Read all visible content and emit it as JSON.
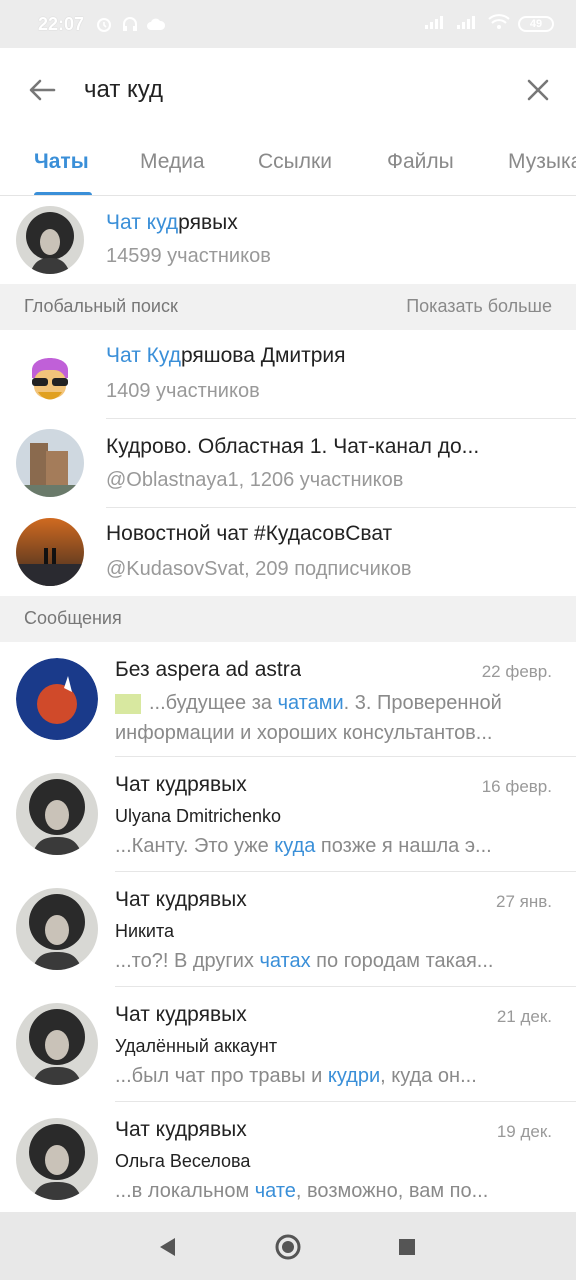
{
  "status_bar": {
    "time": "22:07",
    "battery": "49",
    "icons": [
      "alarm-icon",
      "headset-icon",
      "cloud-icon",
      "signal-icon",
      "signal-icon",
      "wifi-icon",
      "battery-icon"
    ]
  },
  "search": {
    "query": "чат куд",
    "back_icon": "arrow-left-icon",
    "clear_icon": "close-icon"
  },
  "tabs": [
    {
      "label": "Чаты",
      "active": true
    },
    {
      "label": "Медиа",
      "active": false
    },
    {
      "label": "Ссылки",
      "active": false
    },
    {
      "label": "Файлы",
      "active": false
    },
    {
      "label": "Музыка",
      "active": false
    }
  ],
  "local_results": [
    {
      "title_hl": "Чат куд",
      "title_rest": "рявых",
      "subtitle": "14599 участников"
    }
  ],
  "global_section": {
    "label": "Глобальный поиск",
    "more": "Показать больше"
  },
  "global_results": [
    {
      "title_hl": "Чат Куд",
      "title_rest": "ряшова Дмитрия",
      "subtitle": "1409 участников"
    },
    {
      "title_hl": "",
      "title_rest": "Кудрово. Областная 1. Чат-канал до...",
      "subtitle": "@Oblastnaya1, 1206 участников"
    },
    {
      "title_hl": "",
      "title_rest": "Новостной чат #КудасовСват",
      "subtitle": "@KudasovSvat, 209 подписчиков"
    }
  ],
  "messages_section": {
    "label": "Сообщения"
  },
  "messages": [
    {
      "title": "Без aspera ad astra",
      "date": "22 февр.",
      "line1_pre": "...будущее за ",
      "line1_hl": "чатами",
      "line1_post": ". 3. Проверенной",
      "line2": "информации и хороших консультантов..."
    },
    {
      "title": "Чат кудрявых",
      "date": "16 февр.",
      "author": "Ulyana Dmitrichenko",
      "pre": "...Канту. Это уже ",
      "hl": "куда",
      "post": " позже я нашла э..."
    },
    {
      "title": "Чат кудрявых",
      "date": "27 янв.",
      "author": "Никита",
      "pre": "...то?! В других ",
      "hl": "чатах",
      "post": " по городам такая..."
    },
    {
      "title": "Чат кудрявых",
      "date": "21 дек.",
      "author": "Удалённый аккаунт",
      "pre": "...был чат про травы и ",
      "hl": "кудри",
      "post": ", куда он..."
    },
    {
      "title": "Чат кудрявых",
      "date": "19 дек.",
      "author": "Ольга Веселова",
      "pre": "...в локальном ",
      "hl": "чате",
      "post": ", возможно, вам по..."
    }
  ],
  "nav": {
    "icons": [
      "back-triangle-icon",
      "home-circle-icon",
      "recents-square-icon"
    ]
  },
  "colors": {
    "accent": "#3a8fd8",
    "section_bg": "#f1f1f1",
    "secondary_text": "#999999"
  }
}
